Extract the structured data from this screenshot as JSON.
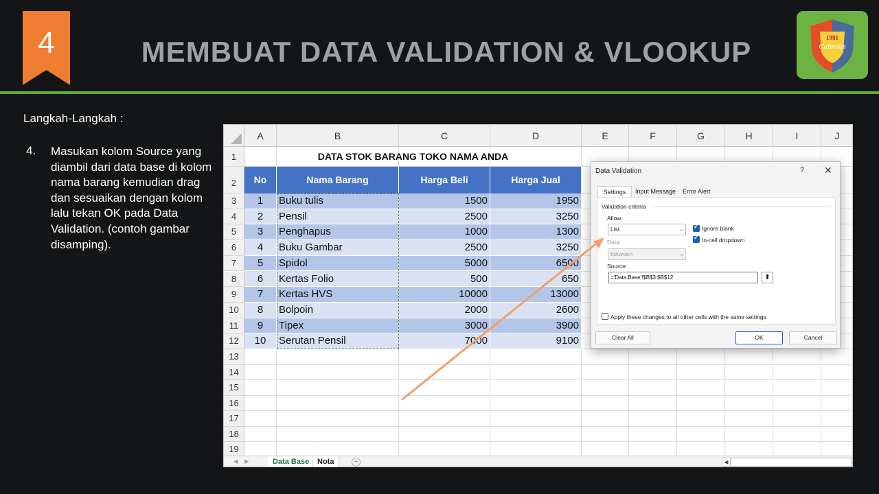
{
  "slide": {
    "step_badge": "4",
    "title": "MEMBUAT DATA VALIDATION & VLOOKUP",
    "logo_year": "1981",
    "logo_name": "Cahndus",
    "steps_heading": "Langkah-Langkah :",
    "step_number": "4.",
    "step_text": "Masukan kolom Source yang diambil dari data base di kolom nama barang kemudian drag dan sesuaikan dengan kolom lalu tekan OK pada Data Validation. (contoh gambar disamping)."
  },
  "colors": {
    "accent_green": "#5fb030",
    "badge_orange": "#ee7d31",
    "table_header": "#4472c4",
    "row_odd": "#b4c6e7",
    "row_even": "#d9e1f2",
    "arrow": "#f0a06a"
  },
  "excel": {
    "columns": [
      "A",
      "B",
      "C",
      "D",
      "E",
      "F",
      "G",
      "H",
      "I",
      "J"
    ],
    "rows": [
      "1",
      "2",
      "3",
      "4",
      "5",
      "6",
      "7",
      "8",
      "9",
      "10",
      "11",
      "12",
      "13",
      "14",
      "15",
      "16",
      "17",
      "18",
      "19"
    ],
    "table_title": "DATA STOK BARANG TOKO NAMA ANDA",
    "headers": [
      "No",
      "Nama Barang",
      "Harga Beli",
      "Harga Jual"
    ],
    "data": [
      [
        "1",
        "Buku tulis",
        "1500",
        "1950"
      ],
      [
        "2",
        "Pensil",
        "2500",
        "3250"
      ],
      [
        "3",
        "Penghapus",
        "1000",
        "1300"
      ],
      [
        "4",
        "Buku Gambar",
        "2500",
        "3250"
      ],
      [
        "5",
        "Spidol",
        "5000",
        "6500"
      ],
      [
        "6",
        "Kertas Folio",
        "500",
        "650"
      ],
      [
        "7",
        "Kertas HVS",
        "10000",
        "13000"
      ],
      [
        "8",
        "Bolpoin",
        "2000",
        "2600"
      ],
      [
        "9",
        "Tipex",
        "3000",
        "3900"
      ],
      [
        "10",
        "Serutan Pensil",
        "7000",
        "9100"
      ]
    ],
    "sheet_tabs": [
      "Data Base",
      "Nota"
    ],
    "add_sheet": "+"
  },
  "dialog": {
    "title": "Data Validation",
    "help": "?",
    "close": "✕",
    "tabs": [
      "Settings",
      "Input Message",
      "Error Alert"
    ],
    "section": "Validation criteria",
    "allow_label": "Allow:",
    "allow_value": "List",
    "ignore_blank": "Ignore blank",
    "in_cell_dropdown": "In-cell dropdown",
    "data_label": "Data:",
    "data_value": "between",
    "source_label": "Source:",
    "source_value": "='Data Base'!$B$3:$B$12",
    "apply_all": "Apply these changes to all other cells with the same settings",
    "clear_all": "Clear All",
    "ok": "OK",
    "cancel": "Cancel"
  }
}
